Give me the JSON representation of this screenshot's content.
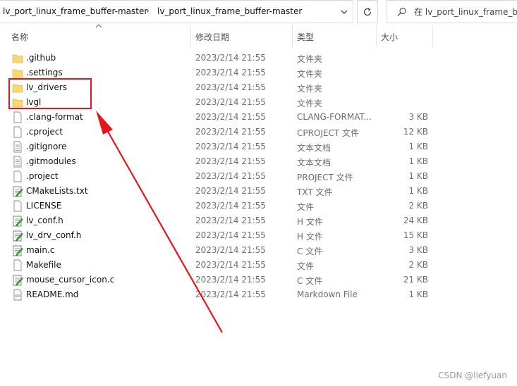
{
  "address": {
    "crumbs": [
      "lv_port_linux_frame_buffer-master",
      "lv_port_linux_frame_buffer-master"
    ],
    "search_placeholder": "在 lv_port_linux_frame_buffer-master 中搜索"
  },
  "columns": {
    "name": "名称",
    "date": "修改日期",
    "type": "类型",
    "size": "大小"
  },
  "files": [
    {
      "name": ".github",
      "date": "2023/2/14 21:55",
      "type": "文件夹",
      "size": "",
      "icon": "folder-icon"
    },
    {
      "name": ".settings",
      "date": "2023/2/14 21:55",
      "type": "文件夹",
      "size": "",
      "icon": "folder-icon"
    },
    {
      "name": "lv_drivers",
      "date": "2023/2/14 21:55",
      "type": "文件夹",
      "size": "",
      "icon": "folder-icon"
    },
    {
      "name": "lvgl",
      "date": "2023/2/14 21:55",
      "type": "文件夹",
      "size": "",
      "icon": "folder-icon"
    },
    {
      "name": ".clang-format",
      "date": "2023/2/14 21:55",
      "type": "CLANG-FORMAT...",
      "size": "3 KB",
      "icon": "blank-file-icon"
    },
    {
      "name": ".cproject",
      "date": "2023/2/14 21:55",
      "type": "CPROJECT 文件",
      "size": "12 KB",
      "icon": "blank-file-icon"
    },
    {
      "name": ".gitignore",
      "date": "2023/2/14 21:55",
      "type": "文本文档",
      "size": "1 KB",
      "icon": "text-file-icon"
    },
    {
      "name": ".gitmodules",
      "date": "2023/2/14 21:55",
      "type": "文本文档",
      "size": "1 KB",
      "icon": "text-file-icon"
    },
    {
      "name": ".project",
      "date": "2023/2/14 21:55",
      "type": "PROJECT 文件",
      "size": "1 KB",
      "icon": "blank-file-icon"
    },
    {
      "name": "CMakeLists.txt",
      "date": "2023/2/14 21:55",
      "type": "TXT 文件",
      "size": "1 KB",
      "icon": "notepad-file-icon"
    },
    {
      "name": "LICENSE",
      "date": "2023/2/14 21:55",
      "type": "文件",
      "size": "2 KB",
      "icon": "blank-file-icon"
    },
    {
      "name": "lv_conf.h",
      "date": "2023/2/14 21:55",
      "type": "H 文件",
      "size": "24 KB",
      "icon": "notepad-file-icon"
    },
    {
      "name": "lv_drv_conf.h",
      "date": "2023/2/14 21:55",
      "type": "H 文件",
      "size": "15 KB",
      "icon": "notepad-file-icon"
    },
    {
      "name": "main.c",
      "date": "2023/2/14 21:55",
      "type": "C 文件",
      "size": "3 KB",
      "icon": "notepad-file-icon"
    },
    {
      "name": "Makefile",
      "date": "2023/2/14 21:55",
      "type": "文件",
      "size": "2 KB",
      "icon": "blank-file-icon"
    },
    {
      "name": "mouse_cursor_icon.c",
      "date": "2023/2/14 21:55",
      "type": "C 文件",
      "size": "21 KB",
      "icon": "notepad-file-icon"
    },
    {
      "name": "README.md",
      "date": "2023/2/14 21:55",
      "type": "Markdown File",
      "size": "1 KB",
      "icon": "markdown-file-icon"
    }
  ],
  "watermark": "CSDN @liefyuan",
  "colors": {
    "annotation": "#e8141c",
    "folder": "#f8d775",
    "text_secondary": "#6d6d6d"
  }
}
